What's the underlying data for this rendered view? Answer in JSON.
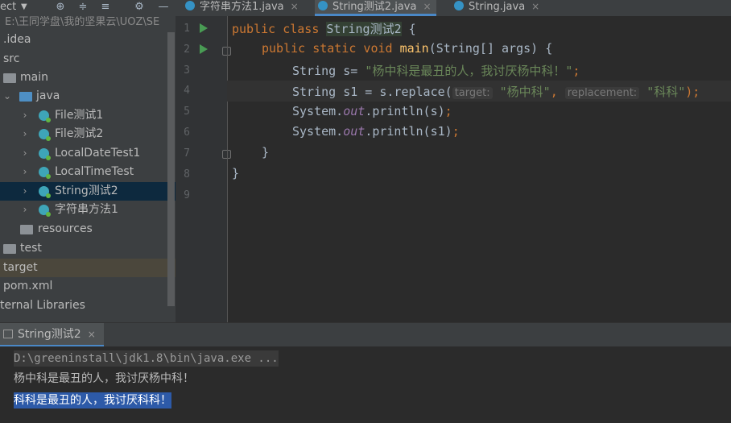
{
  "toolbar": {
    "project_selector": "ect",
    "tabs": [
      {
        "label": "字符串方法1.java",
        "active": false
      },
      {
        "label": "String测试2.java",
        "active": true
      },
      {
        "label": "String.java",
        "active": false
      }
    ]
  },
  "project_tree": {
    "path": "E:\\王同学盘\\我的坚果云\\UOZ\\SE",
    "items": [
      {
        "label": ".idea",
        "type": "folder"
      },
      {
        "label": "src",
        "type": "folder"
      },
      {
        "label": "main",
        "type": "folder"
      },
      {
        "label": "java",
        "type": "source-folder"
      },
      {
        "label": "File测试1",
        "type": "class"
      },
      {
        "label": "File测试2",
        "type": "class"
      },
      {
        "label": "LocalDateTest1",
        "type": "class"
      },
      {
        "label": "LocalTimeTest",
        "type": "class"
      },
      {
        "label": "String测试2",
        "type": "class",
        "selected": true
      },
      {
        "label": "字符串方法1",
        "type": "class"
      },
      {
        "label": "resources",
        "type": "folder"
      },
      {
        "label": "test",
        "type": "folder"
      },
      {
        "label": "target",
        "type": "folder"
      },
      {
        "label": "pom.xml",
        "type": "file"
      },
      {
        "label": "ternal Libraries",
        "type": "library"
      }
    ]
  },
  "editor": {
    "line_numbers": [
      "1",
      "2",
      "3",
      "4",
      "5",
      "6",
      "7",
      "8",
      "9"
    ],
    "code": {
      "l1_kw": "public class ",
      "l1_cls": "String测试2",
      "l1_end": " {",
      "l2_kw": "public static void ",
      "l2_fn": "main",
      "l2_rest": "(String[] args) {",
      "l3_pre": "String s= ",
      "l3_str": "\"杨中科是最丑的人，我讨厌杨中科！\"",
      "l3_end": ";",
      "l4_pre": "String s1 = s.replace(",
      "l4_hint1": "target:",
      "l4_str1": "\"杨中科\"",
      "l4_comma": ",",
      "l4_hint2": "replacement:",
      "l4_str2": "\"科科\"",
      "l4_end": ");",
      "l5_pre": "System.",
      "l5_out": "out",
      "l5_rest": ".println(s)",
      "l5_end": ";",
      "l6_pre": "System.",
      "l6_out": "out",
      "l6_rest": ".println(s1)",
      "l6_end": ";",
      "l7": "}",
      "l8": "}"
    }
  },
  "run_panel": {
    "tab_label": "String测试2",
    "console": [
      "D:\\greeninstall\\jdk1.8\\bin\\java.exe ...",
      "杨中科是最丑的人，我讨厌杨中科！",
      "科科是最丑的人，我讨厌科科！"
    ]
  }
}
